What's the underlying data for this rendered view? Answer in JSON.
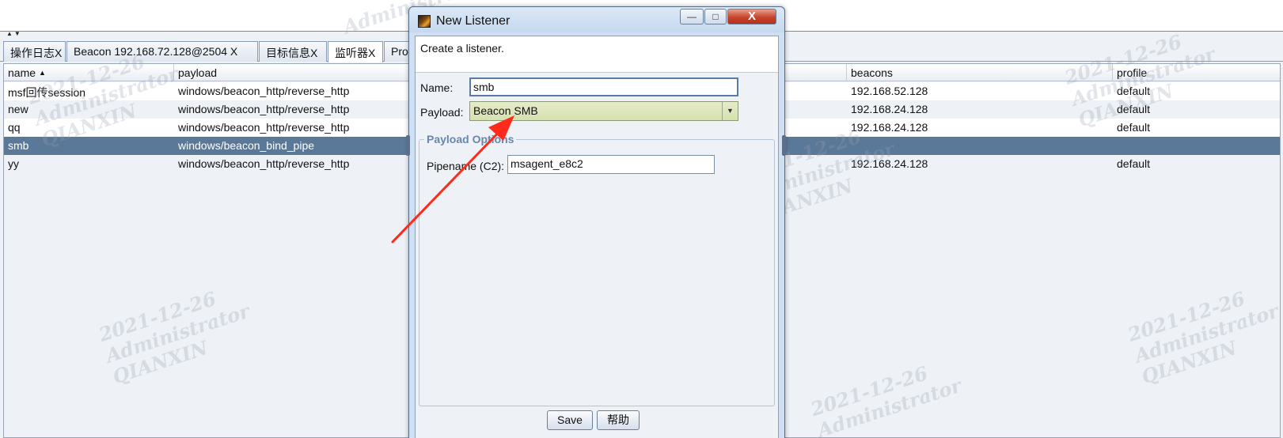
{
  "tabs": [
    {
      "label": "操作日志X",
      "active": false
    },
    {
      "label": "Beacon 192.168.72.128@2504   X",
      "active": false
    },
    {
      "label": "目标信息X",
      "active": false
    },
    {
      "label": "监听器X",
      "active": true
    },
    {
      "label": "Pro",
      "active": false
    }
  ],
  "table": {
    "columns": [
      "name",
      "payload",
      "beacons",
      "profile"
    ],
    "rows": [
      {
        "name": "msf回传session",
        "payload": "windows/beacon_http/reverse_http",
        "beacons": "192.168.52.128",
        "profile": "default",
        "selected": false
      },
      {
        "name": "new",
        "payload": "windows/beacon_http/reverse_http",
        "beacons": "192.168.24.128",
        "profile": "default",
        "selected": false
      },
      {
        "name": "qq",
        "payload": "windows/beacon_http/reverse_http",
        "beacons": "192.168.24.128",
        "profile": "default",
        "selected": false
      },
      {
        "name": "smb",
        "payload": "windows/beacon_bind_pipe",
        "beacons": "",
        "profile": "",
        "selected": true
      },
      {
        "name": "yy",
        "payload": "windows/beacon_http/reverse_http",
        "beacons": "192.168.24.128",
        "profile": "default",
        "selected": false
      }
    ]
  },
  "watermark": {
    "date": "2021-12-26",
    "user": "Administrator",
    "org": "QIANXIN"
  },
  "dialog": {
    "title": "New Listener",
    "description": "Create a listener.",
    "name_label": "Name:",
    "name_value": "smb",
    "payload_label": "Payload:",
    "payload_value": "Beacon SMB",
    "options_title": "Payload Options",
    "pipename_label": "Pipename (C2):",
    "pipename_value": "msagent_e8c2",
    "save_label": "Save",
    "help_label": "帮助",
    "minimize_glyph": "—",
    "maximize_glyph": "□",
    "close_glyph": "X"
  },
  "icons": {
    "sort": "sort-ascending-icon",
    "combo_arrow": "chevron-down-icon",
    "app": "app-logo-icon"
  },
  "colors": {
    "selected_row": "#5a7898",
    "annotation_arrow": "#ff2a1a",
    "combo_bg": "#dfe6bd",
    "group_title": "#6b86ab"
  }
}
